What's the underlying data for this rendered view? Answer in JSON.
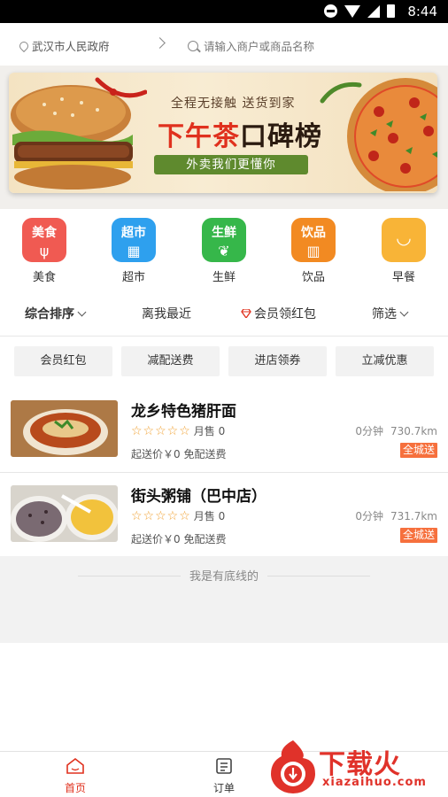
{
  "status_bar": {
    "time": "8:44"
  },
  "header": {
    "location": "武汉市人民政府",
    "search_placeholder": "请输入商户或商品名称"
  },
  "banner": {
    "subtitle": "全程无接触 送货到家",
    "title_accent": "下午茶",
    "title_rest": "口碑榜",
    "tagline": "外卖我们更懂你"
  },
  "categories": [
    {
      "icon_text": "美食",
      "label": "美食",
      "color": "#f05a52",
      "icon": "fork-knife-icon"
    },
    {
      "icon_text": "超市",
      "label": "超市",
      "color": "#2ea0ee",
      "icon": "basket-icon"
    },
    {
      "icon_text": "生鲜",
      "label": "生鲜",
      "color": "#36b74a",
      "icon": "fruit-icon"
    },
    {
      "icon_text": "饮品",
      "label": "饮品",
      "color": "#f28a22",
      "icon": "cup-icon"
    },
    {
      "icon_text": "",
      "label": "早餐",
      "color": "#f8b437",
      "icon": "bowl-icon"
    }
  ],
  "sort_bar": {
    "comprehensive": "综合排序",
    "nearest": "离我最近",
    "member_redpack": "会员领红包",
    "filter": "筛选"
  },
  "chips": [
    "会员红包",
    "减配送费",
    "进店领券",
    "立减优惠"
  ],
  "shops": [
    {
      "name": "龙乡特色猪肝面",
      "monthly_sales": "月售 0",
      "fee_line": "起送价￥0  免配送费",
      "minutes": "0分钟",
      "distance": "730.7km",
      "badge": "全城送"
    },
    {
      "name": "街头粥铺（巴中店）",
      "monthly_sales": "月售 0",
      "fee_line": "起送价￥0  免配送费",
      "minutes": "0分钟",
      "distance": "731.7km",
      "badge": "全城送"
    }
  ],
  "footer_text": "我是有底线的",
  "tabbar": {
    "home": "首页",
    "orders": "订单"
  },
  "watermark": {
    "brand": "下载火",
    "domain": "xiazaihuo.com"
  },
  "colors": {
    "accent": "#e0311e",
    "badge": "#f6703d",
    "star": "#f0a030"
  }
}
